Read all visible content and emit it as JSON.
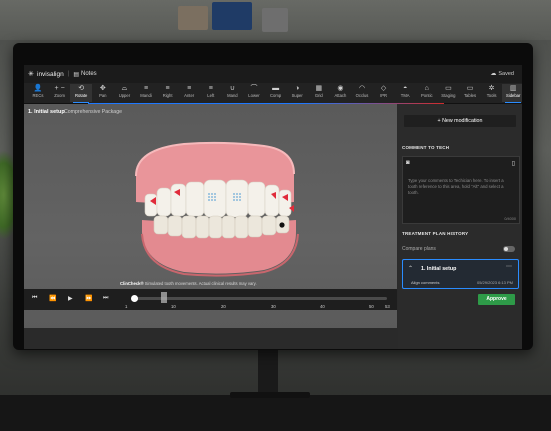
{
  "app": {
    "logo_text": "invisalign",
    "notes_label": "Notes",
    "saved_label": "Saved"
  },
  "toolbar": [
    {
      "label": "RECs",
      "icon": "person-icon",
      "glyph": "👤"
    },
    {
      "label": "Zoom",
      "icon": "zoom-icon",
      "glyph": "+ −"
    },
    {
      "label": "Rotate",
      "icon": "rotate-icon",
      "glyph": "⟲",
      "active": true
    },
    {
      "label": "Pan",
      "icon": "pan-icon",
      "glyph": "✥"
    },
    {
      "label": "Upper",
      "icon": "upper-icon",
      "glyph": "⌓"
    },
    {
      "label": "Mandi",
      "icon": "mandi-icon",
      "glyph": "≡"
    },
    {
      "label": "Right",
      "icon": "right-icon",
      "glyph": "≡"
    },
    {
      "label": "Anter",
      "icon": "anter-icon",
      "glyph": "≡"
    },
    {
      "label": "Left",
      "icon": "left-icon",
      "glyph": "≡"
    },
    {
      "label": "Mand",
      "icon": "mand-icon",
      "glyph": "∪"
    },
    {
      "label": "Lower",
      "icon": "lower-icon",
      "glyph": "⌒"
    },
    {
      "label": "Comp",
      "icon": "comp-icon",
      "glyph": "▬"
    },
    {
      "label": "Super",
      "icon": "super-icon",
      "glyph": "◑"
    },
    {
      "label": "Grid",
      "icon": "grid-icon",
      "glyph": "▦"
    },
    {
      "label": "Attach",
      "icon": "attach-icon",
      "glyph": "◉"
    },
    {
      "label": "Occlus",
      "icon": "occlus-icon",
      "glyph": "◠"
    },
    {
      "label": "IPR",
      "icon": "ipr-icon",
      "glyph": "◇"
    },
    {
      "label": "TMA",
      "icon": "tma-icon",
      "glyph": "◓"
    },
    {
      "label": "Pontic",
      "icon": "pontic-icon",
      "glyph": "⌂"
    },
    {
      "label": "Staging",
      "icon": "staging-icon",
      "glyph": "▭"
    },
    {
      "label": "Tables",
      "icon": "tables-icon",
      "glyph": "▭"
    },
    {
      "label": "Tools",
      "icon": "tools-icon",
      "glyph": "✲"
    },
    {
      "label": "Sidebar",
      "icon": "sidebar-icon",
      "glyph": "▥",
      "active": true
    }
  ],
  "viewport": {
    "title": "1. Initial setup",
    "subtitle": "Comprehensive Package",
    "clincheck_brand": "ClinCheck®",
    "clincheck_text": "Simulated tooth movements. Actual clinical results may vary."
  },
  "timeline": {
    "ticks": [
      "1",
      "10",
      "20",
      "30",
      "40",
      "50",
      "53"
    ],
    "progress": 0.02
  },
  "sidebar": {
    "new_modification": "New modification",
    "comment_header": "COMMENT TO TECH",
    "comment_placeholder": "Type your comments to Techician here. To insert a tooth reference to this area, hold \"Alt\" and select a tooth.",
    "comment_count": "0/4000",
    "history_header": "TREATMENT PLAN HISTORY",
    "compare_label": "Compare plans",
    "stage_name": "1. Initial setup",
    "stage_row_label": "Align comments",
    "stage_row_date": "05/29/2023 6:13 PM",
    "approve_label": "Approve"
  }
}
